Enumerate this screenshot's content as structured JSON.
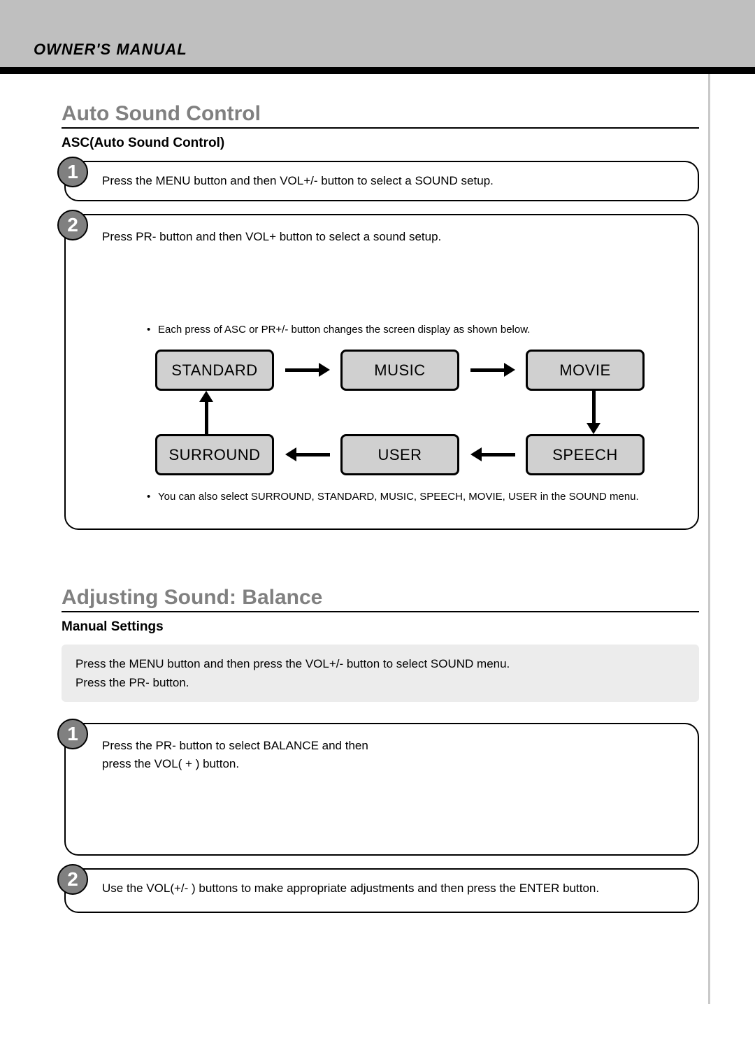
{
  "header": {
    "title": "OWNER'S MANUAL"
  },
  "section1": {
    "title": "Auto Sound Control",
    "subtitle": "ASC(Auto Sound Control)",
    "step1": {
      "num": "1",
      "text": "Press the MENU button and then VOL+/- button to select a SOUND setup."
    },
    "step2": {
      "num": "2",
      "text": "Press PR- button and then VOL+ button to select a sound setup.",
      "bullet1": "Each press of ASC or PR+/- button changes the screen display as shown below.",
      "modes": {
        "standard": "STANDARD",
        "music": "MUSIC",
        "movie": "MOVIE",
        "surround": "SURROUND",
        "user": "USER",
        "speech": "SPEECH"
      },
      "bullet2": "You can also select SURROUND, STANDARD, MUSIC, SPEECH, MOVIE, USER in the SOUND menu."
    }
  },
  "section2": {
    "title": "Adjusting Sound: Balance",
    "subtitle": "Manual Settings",
    "intro_line1": "Press the MENU button and then press the VOL+/- button to select SOUND menu.",
    "intro_line2": "Press the PR- button.",
    "step1": {
      "num": "1",
      "line1": "Press the PR- button to select BALANCE and then",
      "line2": "press the VOL( + ) button."
    },
    "step2": {
      "num": "2",
      "text": "Use the VOL(+/- ) buttons to make appropriate adjustments and then press the ENTER button."
    }
  }
}
